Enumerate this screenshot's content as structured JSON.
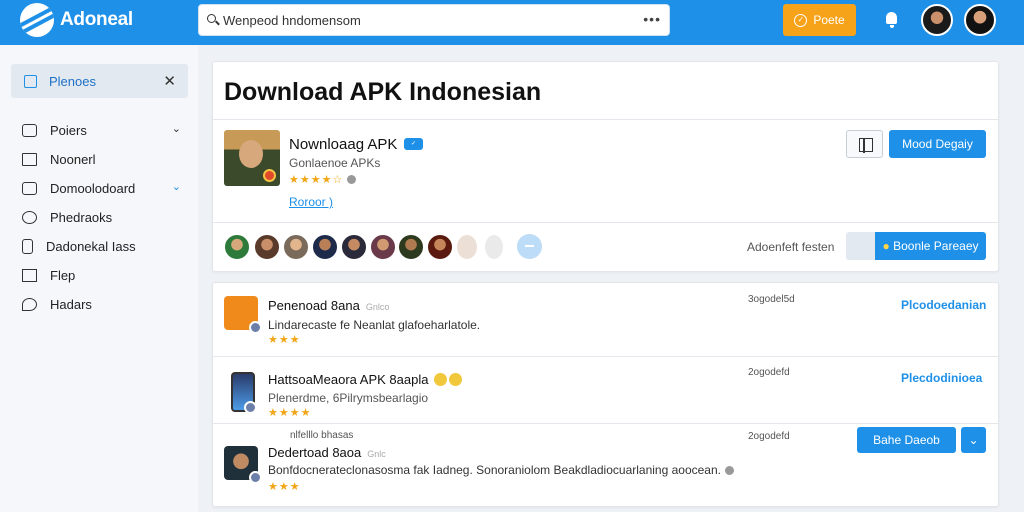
{
  "header": {
    "logo_text": "Adoneal",
    "search_value": "Wenpeod hndomensom",
    "promo_label": "Poete",
    "colors": {
      "topbar": "#1e90e8",
      "promo": "#f7a31a",
      "accent": "#1e90e8"
    }
  },
  "sidebar": {
    "header_label": "Plenoes",
    "items": [
      {
        "label": "Poiers",
        "icon": "folder-icon",
        "chevron": "⌄"
      },
      {
        "label": "Noonerl",
        "icon": "edit-icon"
      },
      {
        "label": "Domoolodoard",
        "icon": "download-icon",
        "chevron": "⌄"
      },
      {
        "label": "Phedraoks",
        "icon": "refresh-icon"
      },
      {
        "label": "Dadonekal Iass",
        "icon": "tablet-icon"
      },
      {
        "label": "Flep",
        "icon": "flag-icon"
      },
      {
        "label": "Hadars",
        "icon": "chat-icon"
      }
    ]
  },
  "main": {
    "title": "Download APK Indonesian",
    "app": {
      "name": "Nownloaag APK",
      "developer": "Gonlaenoe APKs",
      "stars": "★★★★☆",
      "link": "Roroor )",
      "install_label": "Mood Degaiy"
    },
    "recent_label": "Adoenfeft festen",
    "action_label": "Boonle Pareaey"
  },
  "list": [
    {
      "title": "Penenoad 8ana",
      "tag": "Gnlco",
      "desc": "Lindarecaste fe Neanlat glafoeharlatole.",
      "stars": "★★★",
      "date": "3ogodel5d",
      "link": "Plcodoedanian"
    },
    {
      "title": "HattsoaMeaora APK 8aapla",
      "tag": "",
      "desc": "Plenerdme, 6Pilrymsbearlagio",
      "stars": "★★★★",
      "date": "2ogodefd",
      "link": "Plecdodinioea"
    },
    {
      "subtitle": "nlfelllo bhasas",
      "title": "Dedertoad 8aoa",
      "tag": "Gnlc",
      "desc": "Bonfdocnerateclonasosma fak Iadneg. Sonoraniolom Beakdladiocuarlaning aoocean.",
      "stars": "★★★",
      "date": "2ogodefd",
      "button_label": "Bahe Daeob",
      "dropdown": "⌄"
    }
  ]
}
